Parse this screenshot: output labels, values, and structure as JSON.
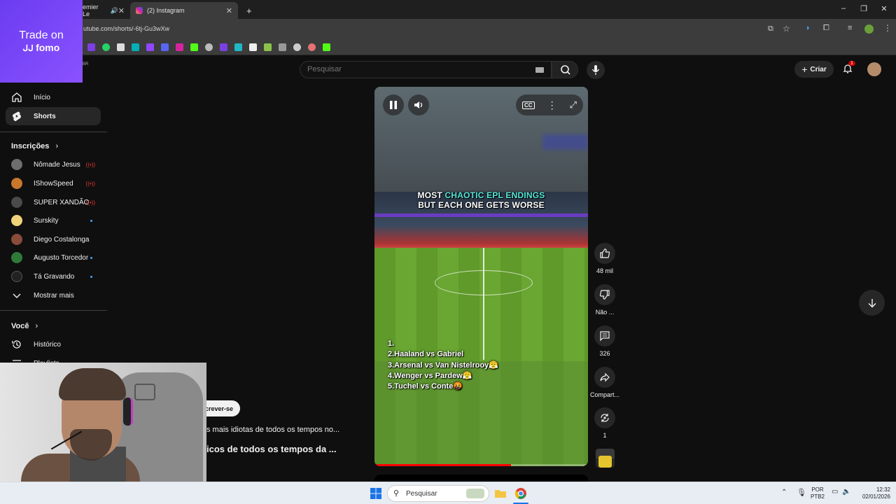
{
  "browser": {
    "tabs": [
      {
        "title": "emier Le"
      },
      {
        "title": "(2) Instagram"
      }
    ],
    "new_tab": "+",
    "url": "utube.com/shorts/-6tj-Gu3wXw"
  },
  "promo": {
    "line1": "Trade on",
    "line2": "fomo"
  },
  "topbar": {
    "country": "BR",
    "search_placeholder": "Pesquisar",
    "create_label": "Criar",
    "notification_count": "1"
  },
  "sidebar": {
    "nav": [
      {
        "label": "Início",
        "icon": "home-icon"
      },
      {
        "label": "Shorts",
        "icon": "shorts-icon"
      }
    ],
    "subscriptions_title": "Inscrições",
    "subscriptions": [
      {
        "name": "Nômade Jesus",
        "status": "live"
      },
      {
        "name": "IShowSpeed",
        "status": "live"
      },
      {
        "name": "SUPER XANDÃO",
        "status": "live"
      },
      {
        "name": "Surskity",
        "status": "new"
      },
      {
        "name": "Diego Costalonga",
        "status": ""
      },
      {
        "name": "Augusto Torcedor",
        "status": "new"
      },
      {
        "name": "Tá Gravando",
        "status": "new"
      }
    ],
    "show_more": "Mostrar mais",
    "you_title": "Você",
    "you_items": [
      {
        "label": "Histórico",
        "icon": "history-icon"
      },
      {
        "label": "Playlists",
        "icon": "playlist-icon"
      }
    ]
  },
  "short": {
    "title_line1_a": "MOST ",
    "title_line1_b": "CHAOTIC EPL ENDINGS",
    "title_line2": "BUT EACH ONE GETS WORSE",
    "list": [
      "1.",
      "2.Haaland vs Gabriel",
      "3.Arsenal vs Van Nistelrooy😤",
      "4.Wenger vs Pardew😤",
      "5.Tuchel vs Conte🤬"
    ],
    "progress": 0.64,
    "subscribe_label": "crever-se",
    "desc_line1": "s mais idiotas de todos os tempos no...",
    "desc_line2": "icos de todos os tempos da ..."
  },
  "actions": {
    "likes": "48 mil",
    "dislike": "Não ...",
    "comments": "326",
    "share": "Compart...",
    "remix": "1"
  },
  "taskbar": {
    "search_placeholder": "Pesquisar",
    "lang_line1": "POR",
    "lang_line2": "PTB2",
    "time": "12:32",
    "date": "02/01/2026"
  },
  "colors": {
    "accent_red": "#ff0000",
    "caption_highlight": "#57e6d6",
    "promo_purple": "#7b45f5"
  }
}
